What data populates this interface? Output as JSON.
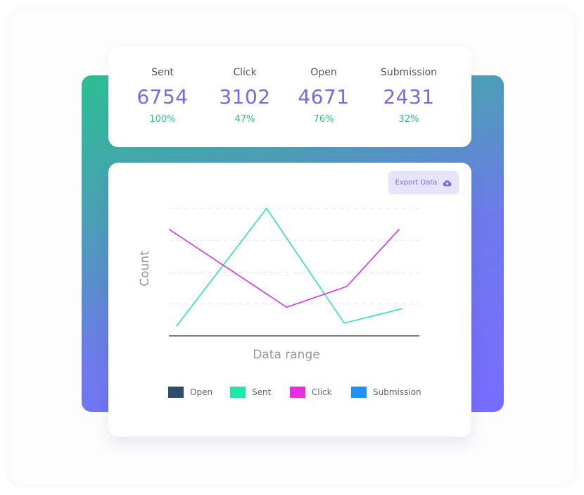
{
  "stats": [
    {
      "label": "Sent",
      "value": "6754",
      "percent": "100%"
    },
    {
      "label": "Click",
      "value": "3102",
      "percent": "47%"
    },
    {
      "label": "Open",
      "value": "4671",
      "percent": "76%"
    },
    {
      "label": "Submission",
      "value": "2431",
      "percent": "32%"
    }
  ],
  "export_button": {
    "label": "Export Data",
    "icon": "cloud-upload-icon"
  },
  "colors": {
    "accent": "#7a6ae0",
    "percent": "#2fbd87",
    "gradient_start": "#2bbf92",
    "gradient_end": "#776cff"
  },
  "chart_data": {
    "type": "line",
    "title": "",
    "xlabel": "Data range",
    "ylabel": "Count",
    "ylim": [
      0,
      4
    ],
    "grid": true,
    "legend_position": "bottom",
    "legend": [
      {
        "name": "Open",
        "color": "#2f4b6e"
      },
      {
        "name": "Sent",
        "color": "#1ee8a6"
      },
      {
        "name": "Click",
        "color": "#e62de0"
      },
      {
        "name": "Submission",
        "color": "#1e90ff"
      }
    ],
    "series": [
      {
        "name": "Sent",
        "color": "#2de3b0",
        "points": [
          [
            0.03,
            0.3
          ],
          [
            0.39,
            4.0
          ],
          [
            0.7,
            0.4
          ],
          [
            0.93,
            0.85
          ]
        ]
      },
      {
        "name": "Click",
        "color": "#dd33dd",
        "points": [
          [
            0.0,
            3.35
          ],
          [
            0.47,
            0.9
          ],
          [
            0.71,
            1.55
          ],
          [
            0.92,
            3.35
          ]
        ]
      }
    ]
  }
}
